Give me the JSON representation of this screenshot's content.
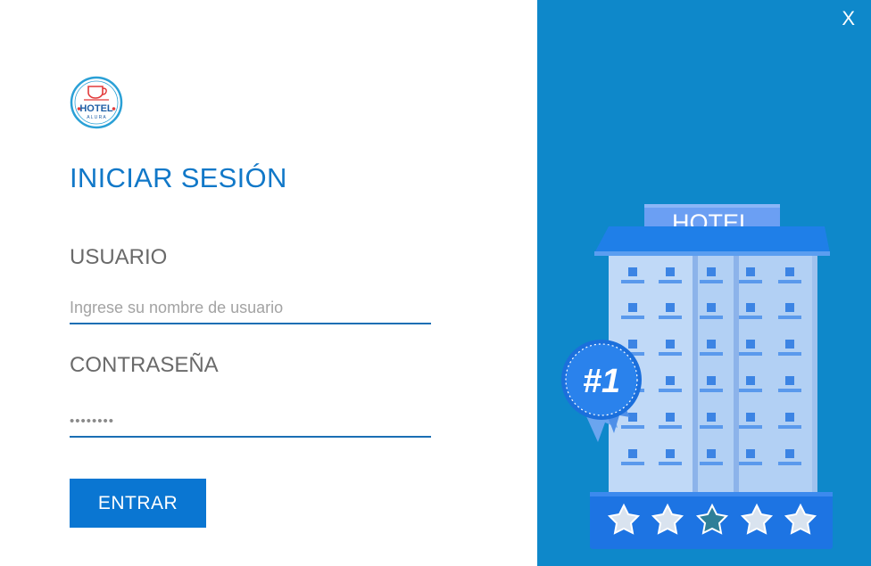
{
  "login": {
    "title": "INICIAR SESIÓN",
    "username_label": "USUARIO",
    "username_placeholder": "Ingrese su nombre de usuario",
    "password_label": "CONTRASEÑA",
    "password_value": "••••••••",
    "submit_label": "ENTRAR"
  },
  "logo": {
    "text_main": "HOTEL",
    "text_sub": "A L U R A"
  },
  "window": {
    "close_label": "X"
  },
  "illustration": {
    "sign_text": "HOTEL",
    "badge_text": "#1",
    "rating_stars": 5
  },
  "colors": {
    "accent": "#1178c8",
    "panel_background": "#0e88ca",
    "button_background": "#0a76d2"
  }
}
